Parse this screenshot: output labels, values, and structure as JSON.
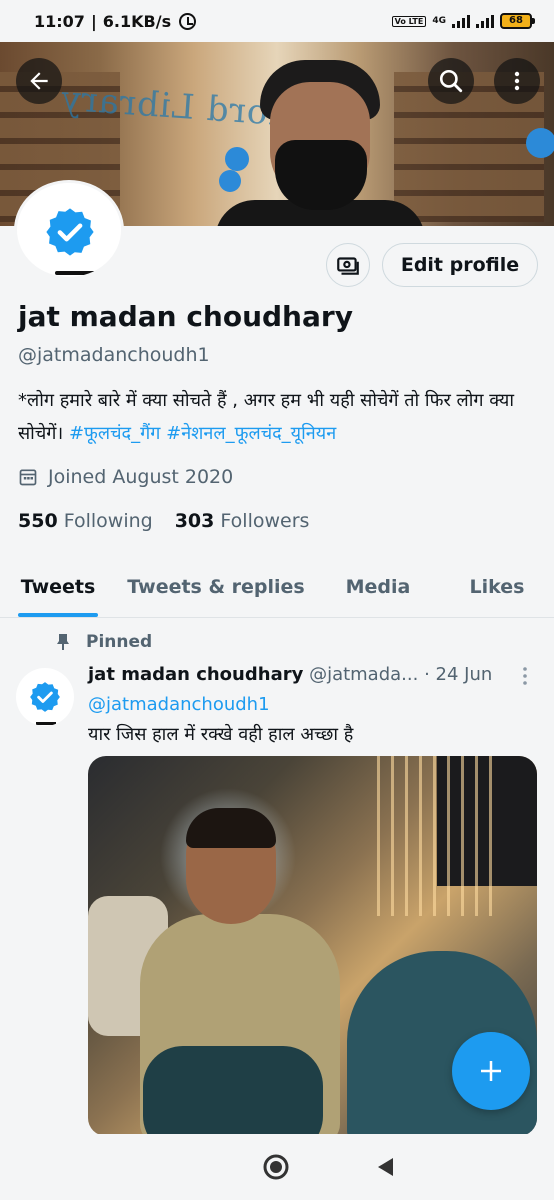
{
  "status_bar": {
    "time": "11:07",
    "speed": "6.1KB/s",
    "volte": "Vo LTE",
    "network": "4G",
    "battery": "68"
  },
  "banner": {
    "text": "Oxford Library"
  },
  "profile": {
    "edit_label": "Edit profile",
    "name": "jat madan choudhary",
    "handle": "@jatmadanchoudh1",
    "bio_text": "*लोग हमारे बारे में क्या सोचते हैं , अगर हम भी यही सोचेगें तो फिर लोग क्या सोचेगें।",
    "bio_tags": [
      "#फूलचंद_गैंग",
      "#नेशनल_फूलचंद_यूनियन"
    ],
    "joined": "Joined August 2020",
    "following_count": "550",
    "following_label": "Following",
    "followers_count": "303",
    "followers_label": "Followers"
  },
  "tabs": [
    {
      "label": "Tweets",
      "active": true
    },
    {
      "label": "Tweets & replies",
      "active": false
    },
    {
      "label": "Media",
      "active": false
    },
    {
      "label": "Likes",
      "active": false
    }
  ],
  "tweet": {
    "pinned_label": "Pinned",
    "author": "jat madan choudhary",
    "handle": "@jatmada...",
    "date": "· 24 Jun",
    "mention": "@jatmadanchoudh1",
    "text": "यार जिस हाल में रक्खे वही हाल अच्छा है"
  },
  "colors": {
    "accent": "#1d9bf0",
    "secondary_text": "#536471",
    "primary_text": "#0f1419"
  }
}
